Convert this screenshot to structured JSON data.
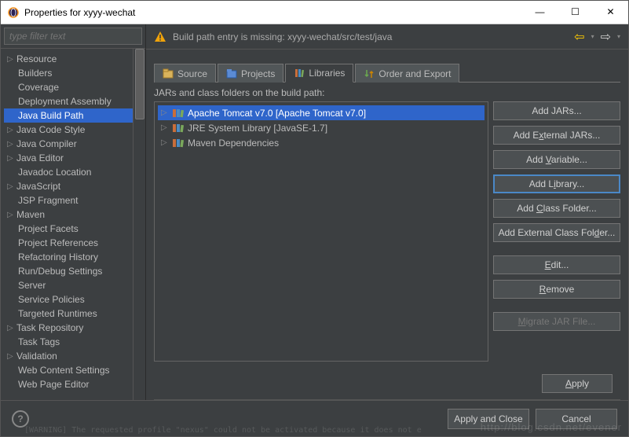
{
  "window": {
    "title": "Properties for xyyy-wechat"
  },
  "filter": {
    "placeholder": "type filter text"
  },
  "sidebar": {
    "items": [
      {
        "label": "Resource",
        "expandable": true,
        "indent": 0
      },
      {
        "label": "Builders",
        "expandable": false,
        "indent": 1
      },
      {
        "label": "Coverage",
        "expandable": false,
        "indent": 1
      },
      {
        "label": "Deployment Assembly",
        "expandable": false,
        "indent": 1
      },
      {
        "label": "Java Build Path",
        "expandable": false,
        "indent": 1,
        "selected": true
      },
      {
        "label": "Java Code Style",
        "expandable": true,
        "indent": 0
      },
      {
        "label": "Java Compiler",
        "expandable": true,
        "indent": 0
      },
      {
        "label": "Java Editor",
        "expandable": true,
        "indent": 0
      },
      {
        "label": "Javadoc Location",
        "expandable": false,
        "indent": 1
      },
      {
        "label": "JavaScript",
        "expandable": true,
        "indent": 0
      },
      {
        "label": "JSP Fragment",
        "expandable": false,
        "indent": 1
      },
      {
        "label": "Maven",
        "expandable": true,
        "indent": 0
      },
      {
        "label": "Project Facets",
        "expandable": false,
        "indent": 1
      },
      {
        "label": "Project References",
        "expandable": false,
        "indent": 1
      },
      {
        "label": "Refactoring History",
        "expandable": false,
        "indent": 1
      },
      {
        "label": "Run/Debug Settings",
        "expandable": false,
        "indent": 1
      },
      {
        "label": "Server",
        "expandable": false,
        "indent": 1
      },
      {
        "label": "Service Policies",
        "expandable": false,
        "indent": 1
      },
      {
        "label": "Targeted Runtimes",
        "expandable": false,
        "indent": 1
      },
      {
        "label": "Task Repository",
        "expandable": true,
        "indent": 0
      },
      {
        "label": "Task Tags",
        "expandable": false,
        "indent": 1
      },
      {
        "label": "Validation",
        "expandable": true,
        "indent": 0
      },
      {
        "label": "Web Content Settings",
        "expandable": false,
        "indent": 1
      },
      {
        "label": "Web Page Editor",
        "expandable": false,
        "indent": 1
      }
    ]
  },
  "warning": {
    "text": "Build path entry is missing: xyyy-wechat/src/test/java"
  },
  "tabs": [
    {
      "label": "Source",
      "icon": "source-icon"
    },
    {
      "label": "Projects",
      "icon": "projects-icon"
    },
    {
      "label": "Libraries",
      "icon": "libraries-icon",
      "active": true
    },
    {
      "label": "Order and Export",
      "icon": "order-icon"
    }
  ],
  "buildpath": {
    "header": "JARs and class folders on the build path:",
    "items": [
      {
        "label": "Apache Tomcat v7.0 [Apache Tomcat v7.0]",
        "selected": true
      },
      {
        "label": "JRE System Library [JavaSE-1.7]"
      },
      {
        "label": "Maven Dependencies"
      }
    ]
  },
  "buttons": {
    "add_jars": "Add JARs...",
    "add_external_jars": "Add External JARs...",
    "add_variable": "Add Variable...",
    "add_library": "Add Library...",
    "add_class_folder": "Add Class Folder...",
    "add_external_class_folder": "Add External Class Folder...",
    "edit": "Edit...",
    "remove": "Remove",
    "migrate": "Migrate JAR File...",
    "apply": "Apply",
    "apply_close": "Apply and Close",
    "cancel": "Cancel"
  },
  "watermark": "http://blog.csdn.net/evener",
  "truncated_footer": "[WARNING] The requested profile \"nexus\" could not be activated because it does not e"
}
